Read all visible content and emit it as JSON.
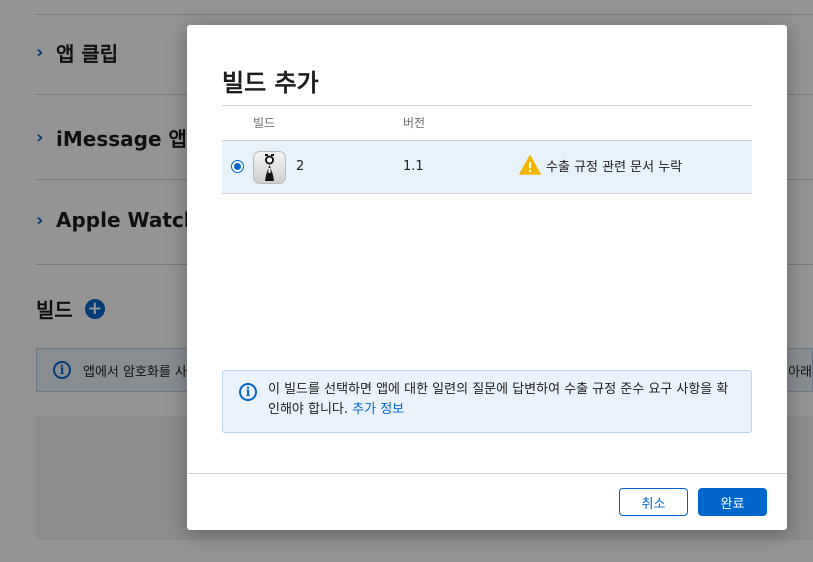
{
  "background": {
    "sections": [
      {
        "label": "앱 클립"
      },
      {
        "label": "iMessage 앱"
      },
      {
        "label": "Apple Watch"
      }
    ],
    "builds_heading": "빌드",
    "banner_text": "앱에서 암호화를 사용",
    "banner_right_text": ", 아래"
  },
  "modal": {
    "title": "빌드 추가",
    "table": {
      "headers": {
        "build": "빌드",
        "version": "버전"
      },
      "rows": [
        {
          "build": "2",
          "version": "1.1",
          "status": "수출 규정 관련 문서 누락",
          "selected": true
        }
      ]
    },
    "info": {
      "text": "이 빌드를 선택하면 앱에 대한 일련의 질문에 답변하여 수출 규정 준수 요구 사항을 확인해야 합니다.",
      "link": "추가 정보"
    },
    "buttons": {
      "cancel": "취소",
      "done": "완료"
    }
  },
  "colors": {
    "accent": "#0066cc",
    "warning": "#f5b400",
    "selected_row": "#e8f2fb"
  }
}
